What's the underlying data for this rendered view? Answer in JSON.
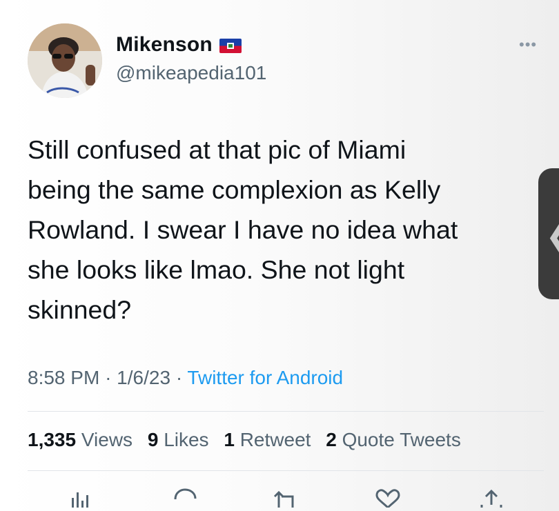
{
  "user": {
    "display_name": "Mikenson",
    "handle": "@mikeapedia101",
    "flag_icon": "haiti-flag"
  },
  "tweet": {
    "text_lines": [
      "Still confused at that pic of Miami",
      "being the same complexion as Kelly",
      "Rowland. I swear I have no idea what",
      "she looks like lmao. She not light",
      "skinned?"
    ],
    "time": "8:58 PM",
    "separator": "·",
    "date": "1/6/23",
    "source": "Twitter for Android"
  },
  "stats": {
    "views_count": "1,335",
    "views_label": "Views",
    "likes_count": "9",
    "likes_label": "Likes",
    "retweets_count": "1",
    "retweets_label": "Retweet",
    "quotes_count": "2",
    "quotes_label": "Quote Tweets"
  },
  "actions": [
    "analytics-icon",
    "reply-icon",
    "retweet-icon",
    "like-icon",
    "share-icon"
  ],
  "side_tab": {
    "arrow": "❮"
  },
  "colors": {
    "text": "#0f1419",
    "secondary": "#536471",
    "link": "#1d9bf0",
    "icon": "#536471"
  }
}
